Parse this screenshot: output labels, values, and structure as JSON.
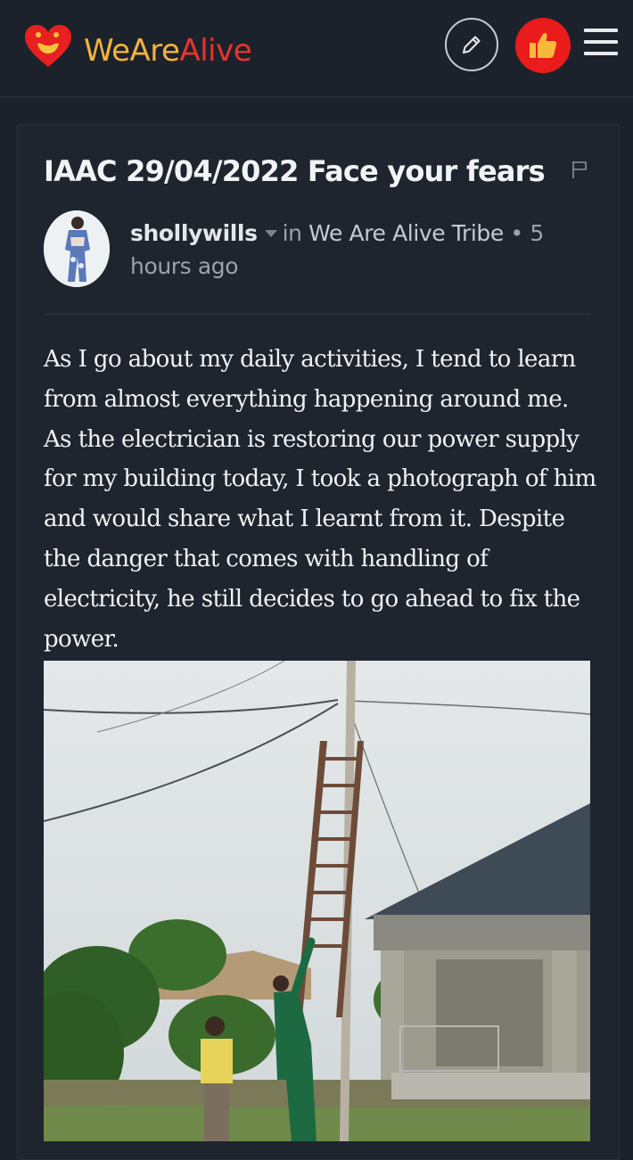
{
  "header": {
    "logo_part1": "WeAre",
    "logo_part2": "Alive",
    "icons": [
      "heart-logo-icon",
      "pencil-icon",
      "thumbs-up-icon",
      "hamburger-menu-icon"
    ],
    "colors": {
      "logo_yellow": "#f2b33d",
      "logo_red": "#e8342d",
      "vote_red": "#ea1b1b"
    }
  },
  "post": {
    "title": "IAAC 29/04/2022 Face your fears",
    "author": "shollywills",
    "in_label": "in",
    "community": "We Are Alive Tribe",
    "time_sep": " • ",
    "time": "5 hours ago",
    "body": "As I go about my daily activities, I tend to learn from almost everything happening around me. As the electrician is restoring our power supply for my building today, I took a photograph of him and would share what I learnt from it. Despite the danger that comes with handling of electricity, he still decides to go ahead to fix the power."
  }
}
